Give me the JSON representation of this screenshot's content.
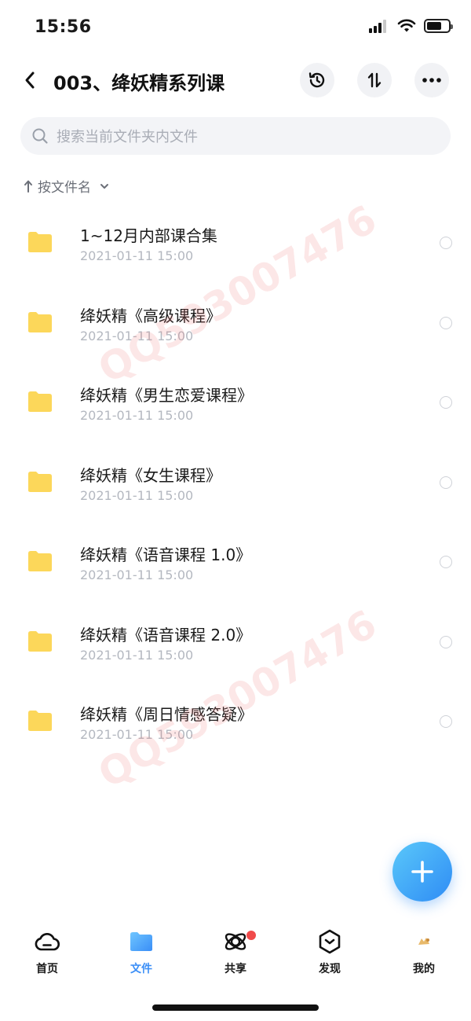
{
  "status_bar": {
    "time": "15:56"
  },
  "header": {
    "title": "003、绛妖精系列课"
  },
  "search": {
    "placeholder": "搜索当前文件夹内文件"
  },
  "sort": {
    "label": "按文件名"
  },
  "files": [
    {
      "name": "1~12月内部课合集",
      "date": "2021-01-11 15:00"
    },
    {
      "name": "绛妖精《高级课程》",
      "date": "2021-01-11 15:00"
    },
    {
      "name": "绛妖精《男生恋爱课程》",
      "date": "2021-01-11 15:00"
    },
    {
      "name": "绛妖精《女生课程》",
      "date": "2021-01-11 15:00"
    },
    {
      "name": "绛妖精《语音课程 1.0》",
      "date": "2021-01-11 15:00"
    },
    {
      "name": "绛妖精《语音课程 2.0》",
      "date": "2021-01-11 15:00"
    },
    {
      "name": "绛妖精《周日情感答疑》",
      "date": "2021-01-11 15:00"
    }
  ],
  "watermark": {
    "text": "QQ593007476"
  },
  "tabs": [
    {
      "label": "首页",
      "icon": "cloud-icon"
    },
    {
      "label": "文件",
      "icon": "folder-icon",
      "active": true
    },
    {
      "label": "共享",
      "icon": "orbit-icon",
      "badge": true
    },
    {
      "label": "发现",
      "icon": "compass-icon"
    },
    {
      "label": "我的",
      "icon": "avatar-icon"
    }
  ],
  "colors": {
    "accent": "#3a8ef7",
    "folder": "#fcd75a",
    "badge": "#f04a4a"
  }
}
